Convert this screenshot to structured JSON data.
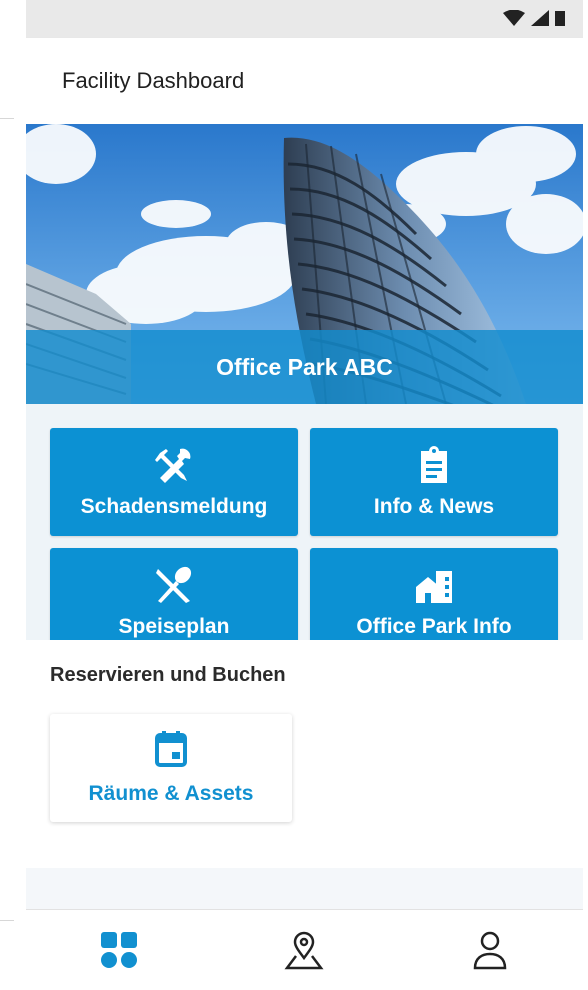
{
  "app": {
    "title": "Facility Dashboard"
  },
  "hero": {
    "title": "Office Park ABC"
  },
  "tiles": [
    {
      "label": "Schadensmeldung",
      "icon": "tools-icon"
    },
    {
      "label": "Info & News",
      "icon": "clipboard-icon"
    },
    {
      "label": "Speiseplan",
      "icon": "cutlery-icon"
    },
    {
      "label": "Office Park Info",
      "icon": "building-icon"
    }
  ],
  "reserve": {
    "section_title": "Reservieren und Buchen",
    "card_label": "Räume & Assets",
    "card_icon": "calendar-icon"
  },
  "bottom_nav": [
    {
      "icon": "dashboard-icon",
      "active": true
    },
    {
      "icon": "map-pin-icon",
      "active": false
    },
    {
      "icon": "user-icon",
      "active": false
    }
  ],
  "colors": {
    "accent": "#0c91d3",
    "status_bar": "#e9e9e9"
  }
}
